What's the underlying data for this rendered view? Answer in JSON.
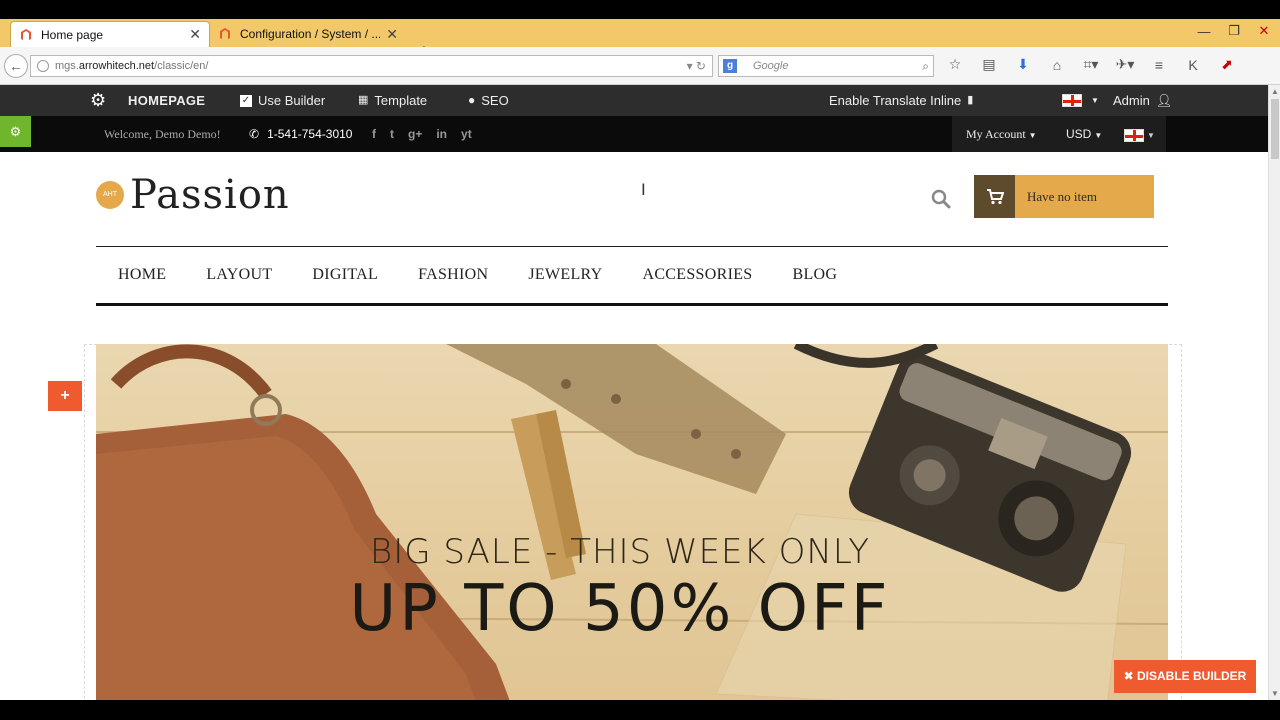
{
  "browser": {
    "tabs": [
      {
        "title": "Home page",
        "active": true
      },
      {
        "title": "Configuration / System / ...",
        "active": false
      }
    ],
    "new_tab": "+",
    "url_prefix": "mgs.",
    "url_domain": "arrowhitech.net",
    "url_path": "/classic/en/",
    "search_placeholder": "Google",
    "window_controls": {
      "minimize": "—",
      "restore": "❐",
      "close": "✕"
    }
  },
  "admin_bar": {
    "homepage": "HOMEPAGE",
    "use_builder": "Use Builder",
    "template": "Template",
    "seo": "SEO",
    "translate": "Enable Translate Inline",
    "admin": "Admin"
  },
  "top_bar": {
    "welcome": "Welcome, Demo Demo!",
    "phone": "1-541-754-3010",
    "social": [
      "f",
      "t",
      "g+",
      "in",
      "yt"
    ],
    "my_account": "My Account",
    "currency": "USD"
  },
  "header": {
    "logo_badge": "AHT",
    "logo_text": "Passion",
    "cart_label": "Have no item"
  },
  "menu": {
    "items": [
      "HOME",
      "LAYOUT",
      "DIGITAL",
      "FASHION",
      "JEWELRY",
      "ACCESSORIES",
      "BLOG"
    ]
  },
  "hero": {
    "subtitle": "BIG SALE - THIS WEEK ONLY",
    "title": "UP TO 50% OFF"
  },
  "builder": {
    "disable_label": "✖ DISABLE BUILDER",
    "add_label": "+"
  },
  "colors": {
    "accent_orange": "#ef5b2f",
    "cart_gold": "#e4a94b",
    "green": "#6fb62c",
    "tab_yellow": "#f2c869"
  }
}
